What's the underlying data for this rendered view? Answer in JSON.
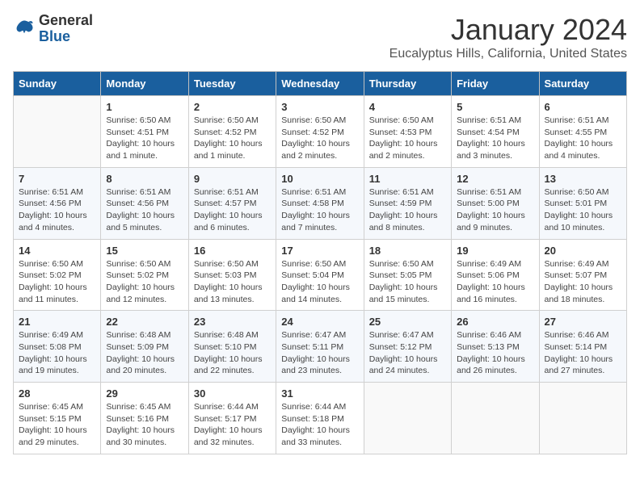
{
  "logo": {
    "general": "General",
    "blue": "Blue"
  },
  "title": "January 2024",
  "location": "Eucalyptus Hills, California, United States",
  "headers": [
    "Sunday",
    "Monday",
    "Tuesday",
    "Wednesday",
    "Thursday",
    "Friday",
    "Saturday"
  ],
  "weeks": [
    [
      {
        "day": "",
        "info": ""
      },
      {
        "day": "1",
        "info": "Sunrise: 6:50 AM\nSunset: 4:51 PM\nDaylight: 10 hours\nand 1 minute."
      },
      {
        "day": "2",
        "info": "Sunrise: 6:50 AM\nSunset: 4:52 PM\nDaylight: 10 hours\nand 1 minute."
      },
      {
        "day": "3",
        "info": "Sunrise: 6:50 AM\nSunset: 4:52 PM\nDaylight: 10 hours\nand 2 minutes."
      },
      {
        "day": "4",
        "info": "Sunrise: 6:50 AM\nSunset: 4:53 PM\nDaylight: 10 hours\nand 2 minutes."
      },
      {
        "day": "5",
        "info": "Sunrise: 6:51 AM\nSunset: 4:54 PM\nDaylight: 10 hours\nand 3 minutes."
      },
      {
        "day": "6",
        "info": "Sunrise: 6:51 AM\nSunset: 4:55 PM\nDaylight: 10 hours\nand 4 minutes."
      }
    ],
    [
      {
        "day": "7",
        "info": "Sunrise: 6:51 AM\nSunset: 4:56 PM\nDaylight: 10 hours\nand 4 minutes."
      },
      {
        "day": "8",
        "info": "Sunrise: 6:51 AM\nSunset: 4:56 PM\nDaylight: 10 hours\nand 5 minutes."
      },
      {
        "day": "9",
        "info": "Sunrise: 6:51 AM\nSunset: 4:57 PM\nDaylight: 10 hours\nand 6 minutes."
      },
      {
        "day": "10",
        "info": "Sunrise: 6:51 AM\nSunset: 4:58 PM\nDaylight: 10 hours\nand 7 minutes."
      },
      {
        "day": "11",
        "info": "Sunrise: 6:51 AM\nSunset: 4:59 PM\nDaylight: 10 hours\nand 8 minutes."
      },
      {
        "day": "12",
        "info": "Sunrise: 6:51 AM\nSunset: 5:00 PM\nDaylight: 10 hours\nand 9 minutes."
      },
      {
        "day": "13",
        "info": "Sunrise: 6:50 AM\nSunset: 5:01 PM\nDaylight: 10 hours\nand 10 minutes."
      }
    ],
    [
      {
        "day": "14",
        "info": "Sunrise: 6:50 AM\nSunset: 5:02 PM\nDaylight: 10 hours\nand 11 minutes."
      },
      {
        "day": "15",
        "info": "Sunrise: 6:50 AM\nSunset: 5:02 PM\nDaylight: 10 hours\nand 12 minutes."
      },
      {
        "day": "16",
        "info": "Sunrise: 6:50 AM\nSunset: 5:03 PM\nDaylight: 10 hours\nand 13 minutes."
      },
      {
        "day": "17",
        "info": "Sunrise: 6:50 AM\nSunset: 5:04 PM\nDaylight: 10 hours\nand 14 minutes."
      },
      {
        "day": "18",
        "info": "Sunrise: 6:50 AM\nSunset: 5:05 PM\nDaylight: 10 hours\nand 15 minutes."
      },
      {
        "day": "19",
        "info": "Sunrise: 6:49 AM\nSunset: 5:06 PM\nDaylight: 10 hours\nand 16 minutes."
      },
      {
        "day": "20",
        "info": "Sunrise: 6:49 AM\nSunset: 5:07 PM\nDaylight: 10 hours\nand 18 minutes."
      }
    ],
    [
      {
        "day": "21",
        "info": "Sunrise: 6:49 AM\nSunset: 5:08 PM\nDaylight: 10 hours\nand 19 minutes."
      },
      {
        "day": "22",
        "info": "Sunrise: 6:48 AM\nSunset: 5:09 PM\nDaylight: 10 hours\nand 20 minutes."
      },
      {
        "day": "23",
        "info": "Sunrise: 6:48 AM\nSunset: 5:10 PM\nDaylight: 10 hours\nand 22 minutes."
      },
      {
        "day": "24",
        "info": "Sunrise: 6:47 AM\nSunset: 5:11 PM\nDaylight: 10 hours\nand 23 minutes."
      },
      {
        "day": "25",
        "info": "Sunrise: 6:47 AM\nSunset: 5:12 PM\nDaylight: 10 hours\nand 24 minutes."
      },
      {
        "day": "26",
        "info": "Sunrise: 6:46 AM\nSunset: 5:13 PM\nDaylight: 10 hours\nand 26 minutes."
      },
      {
        "day": "27",
        "info": "Sunrise: 6:46 AM\nSunset: 5:14 PM\nDaylight: 10 hours\nand 27 minutes."
      }
    ],
    [
      {
        "day": "28",
        "info": "Sunrise: 6:45 AM\nSunset: 5:15 PM\nDaylight: 10 hours\nand 29 minutes."
      },
      {
        "day": "29",
        "info": "Sunrise: 6:45 AM\nSunset: 5:16 PM\nDaylight: 10 hours\nand 30 minutes."
      },
      {
        "day": "30",
        "info": "Sunrise: 6:44 AM\nSunset: 5:17 PM\nDaylight: 10 hours\nand 32 minutes."
      },
      {
        "day": "31",
        "info": "Sunrise: 6:44 AM\nSunset: 5:18 PM\nDaylight: 10 hours\nand 33 minutes."
      },
      {
        "day": "",
        "info": ""
      },
      {
        "day": "",
        "info": ""
      },
      {
        "day": "",
        "info": ""
      }
    ]
  ]
}
